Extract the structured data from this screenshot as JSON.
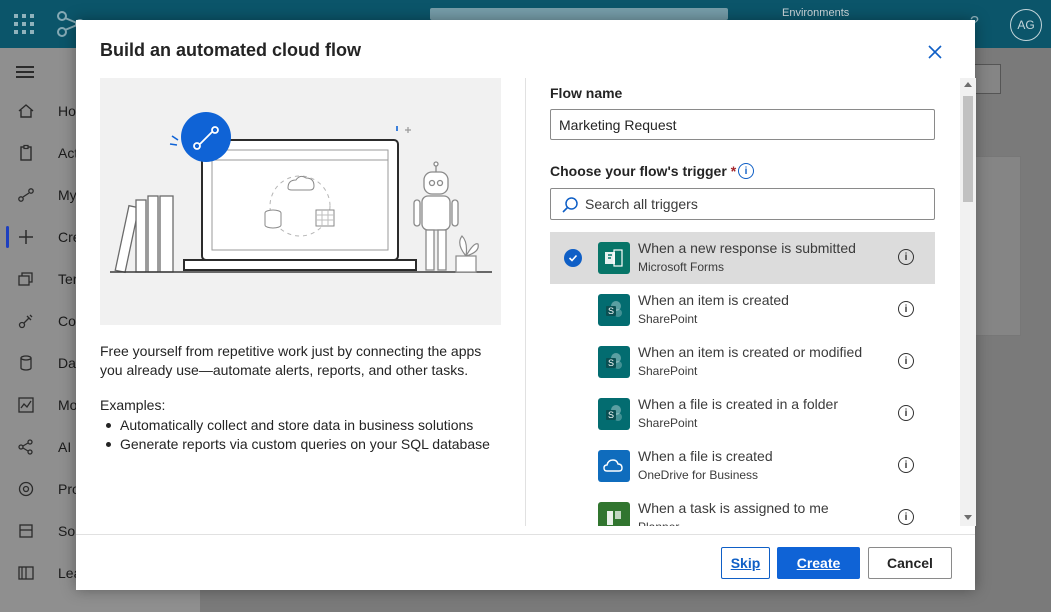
{
  "background": {
    "environment_label": "Environments",
    "avatar_initials": "AG",
    "nav_items": [
      {
        "label": "Ho",
        "icon": "home-icon"
      },
      {
        "label": "Act",
        "icon": "clipboard-icon"
      },
      {
        "label": "My",
        "icon": "flow-icon"
      },
      {
        "label": "Cre",
        "icon": "plus-icon"
      },
      {
        "label": "Ter",
        "icon": "templates-icon"
      },
      {
        "label": "Co",
        "icon": "connectors-icon"
      },
      {
        "label": "Da",
        "icon": "database-icon"
      },
      {
        "label": "Mo",
        "icon": "monitor-icon"
      },
      {
        "label": "AI",
        "icon": "ai-hub-icon"
      },
      {
        "label": "Pro",
        "icon": "process-icon"
      },
      {
        "label": "Sol",
        "icon": "solutions-icon"
      },
      {
        "label": "Lea",
        "icon": "learn-icon"
      }
    ]
  },
  "dialog": {
    "title": "Build an automated cloud flow",
    "intro": "Free yourself from repetitive work just by connecting the apps you already use—automate alerts, reports, and other tasks.",
    "examples_title": "Examples:",
    "examples": [
      "Automatically collect and store data in business solutions",
      "Generate reports via custom queries on your SQL database"
    ],
    "flow_name_label": "Flow name",
    "flow_name_value": "Marketing Request",
    "trigger_label": "Choose your flow's trigger",
    "required_mark": "*",
    "search_placeholder": "Search all triggers",
    "triggers": [
      {
        "name": "When a new response is submitted",
        "connector": "Microsoft Forms",
        "icon": "microsoft-forms-icon",
        "color": "#077568",
        "selected": true
      },
      {
        "name": "When an item is created",
        "connector": "SharePoint",
        "icon": "sharepoint-icon",
        "color": "#036c70",
        "selected": false
      },
      {
        "name": "When an item is created or modified",
        "connector": "SharePoint",
        "icon": "sharepoint-icon",
        "color": "#036c70",
        "selected": false
      },
      {
        "name": "When a file is created in a folder",
        "connector": "SharePoint",
        "icon": "sharepoint-icon",
        "color": "#036c70",
        "selected": false
      },
      {
        "name": "When a file is created",
        "connector": "OneDrive for Business",
        "icon": "onedrive-icon",
        "color": "#0f6cbd",
        "selected": false
      },
      {
        "name": "When a task is assigned to me",
        "connector": "Planner",
        "icon": "planner-icon",
        "color": "#31752f",
        "selected": false
      }
    ],
    "buttons": {
      "skip": "Skip",
      "create": "Create",
      "cancel": "Cancel"
    },
    "accent_color": "#0f63d6"
  }
}
